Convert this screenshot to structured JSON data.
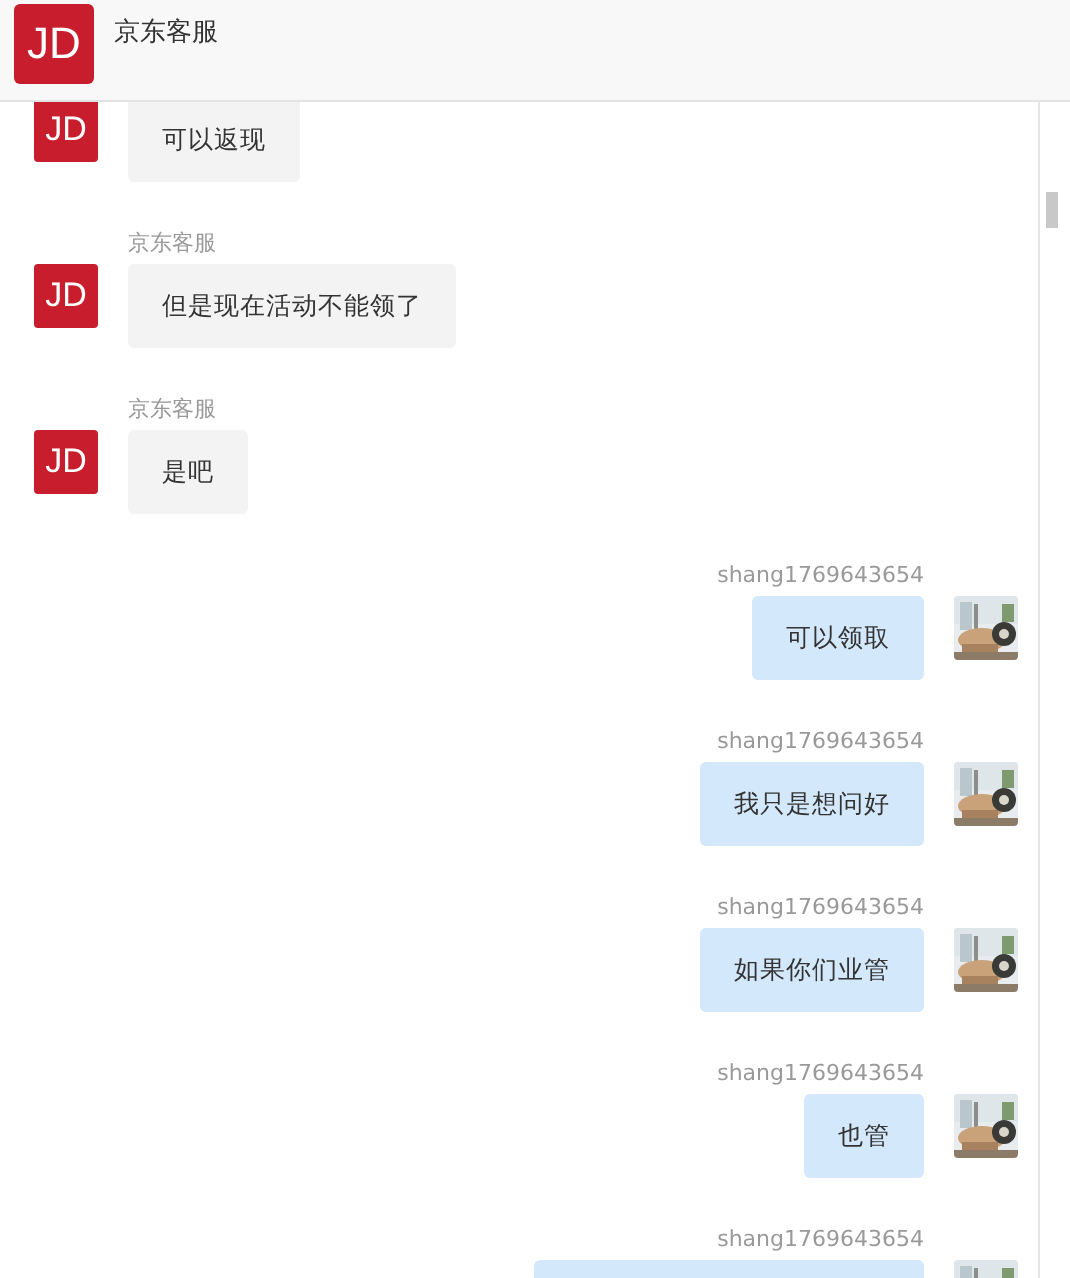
{
  "header": {
    "avatar": "JD",
    "title": "京东客服"
  },
  "messages": [
    {
      "kind": "received",
      "avatar": "JD",
      "text": "可以返现"
    },
    {
      "kind": "received",
      "avatar": "JD",
      "sender": "京东客服",
      "text": "但是现在活动不能领了"
    },
    {
      "kind": "received",
      "avatar": "JD",
      "sender": "京东客服",
      "text": "是吧"
    },
    {
      "kind": "sent",
      "sender": "shang1769643654",
      "text": "可以领取"
    },
    {
      "kind": "sent",
      "sender": "shang1769643654",
      "text": "我只是想问好"
    },
    {
      "kind": "sent",
      "sender": "shang1769643654",
      "text": "如果你们业管"
    },
    {
      "kind": "sent",
      "sender": "shang1769643654",
      "text": "也管"
    },
    {
      "kind": "sent",
      "sender": "shang1769643654"
    }
  ]
}
